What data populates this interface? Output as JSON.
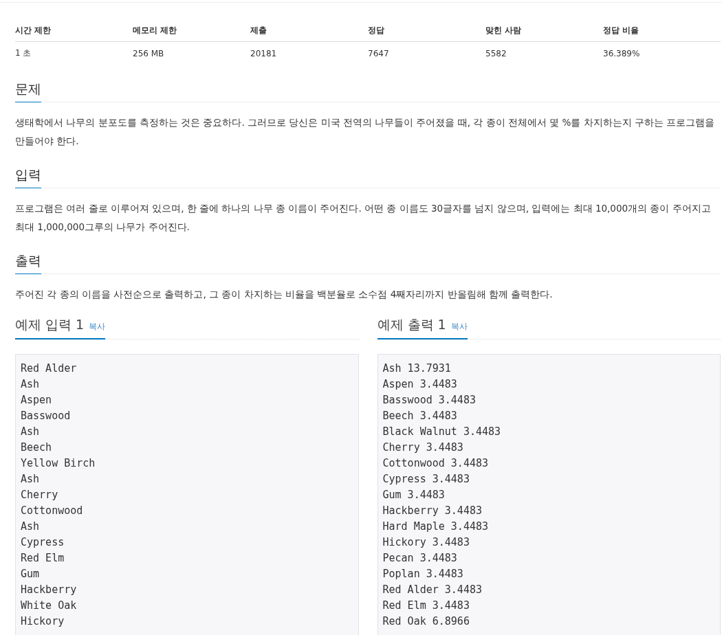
{
  "stats_table": {
    "columns": [
      "시간 제한",
      "메모리 제한",
      "제출",
      "정답",
      "맞힌 사람",
      "정답 비율"
    ],
    "rows": [
      [
        "1 초",
        "256 MB",
        "20181",
        "7647",
        "5582",
        "36.389%"
      ]
    ]
  },
  "sections": [
    {
      "title": "문제",
      "text": "생태학에서 나무의 분포도를 측정하는 것은 중요하다. 그러므로 당신은 미국 전역의 나무들이 주어졌을 때, 각 종이 전체에서 몇 %를 차지하는지 구하는 프로그램을 만들어야 한다."
    },
    {
      "title": "입력",
      "text": "프로그램은 여러 줄로 이루어져 있으며, 한 줄에 하나의 나무 종 이름이 주어진다. 어떤 종 이름도 30글자를 넘지 않으며, 입력에는 최대 10,000개의 종이 주어지고 최대 1,000,000그루의 나무가 주어진다."
    },
    {
      "title": "출력",
      "text": "주어진 각 종의 이름을 사전순으로 출력하고, 그 종이 차지하는 비율을 백분율로 소수점 4째자리까지 반올림해 함께 출력한다."
    }
  ],
  "samples": [
    {
      "title": "예제 입력 1",
      "copy": "복사",
      "lines": [
        "Red Alder",
        "Ash",
        "Aspen",
        "Basswood",
        "Ash",
        "Beech",
        "Yellow Birch",
        "Ash",
        "Cherry",
        "Cottonwood",
        "Ash",
        "Cypress",
        "Red Elm",
        "Gum",
        "Hackberry",
        "White Oak",
        "Hickory"
      ]
    },
    {
      "title": "예제 출력 1",
      "copy": "복사",
      "lines": [
        "Ash 13.7931",
        "Aspen 3.4483",
        "Basswood 3.4483",
        "Beech 3.4483",
        "Black Walnut 3.4483",
        "Cherry 3.4483",
        "Cottonwood 3.4483",
        "Cypress 3.4483",
        "Gum 3.4483",
        "Hackberry 3.4483",
        "Hard Maple 3.4483",
        "Hickory 3.4483",
        "Pecan 3.4483",
        "Poplan 3.4483",
        "Red Alder 3.4483",
        "Red Elm 3.4483",
        "Red Oak 6.8966"
      ]
    }
  ]
}
